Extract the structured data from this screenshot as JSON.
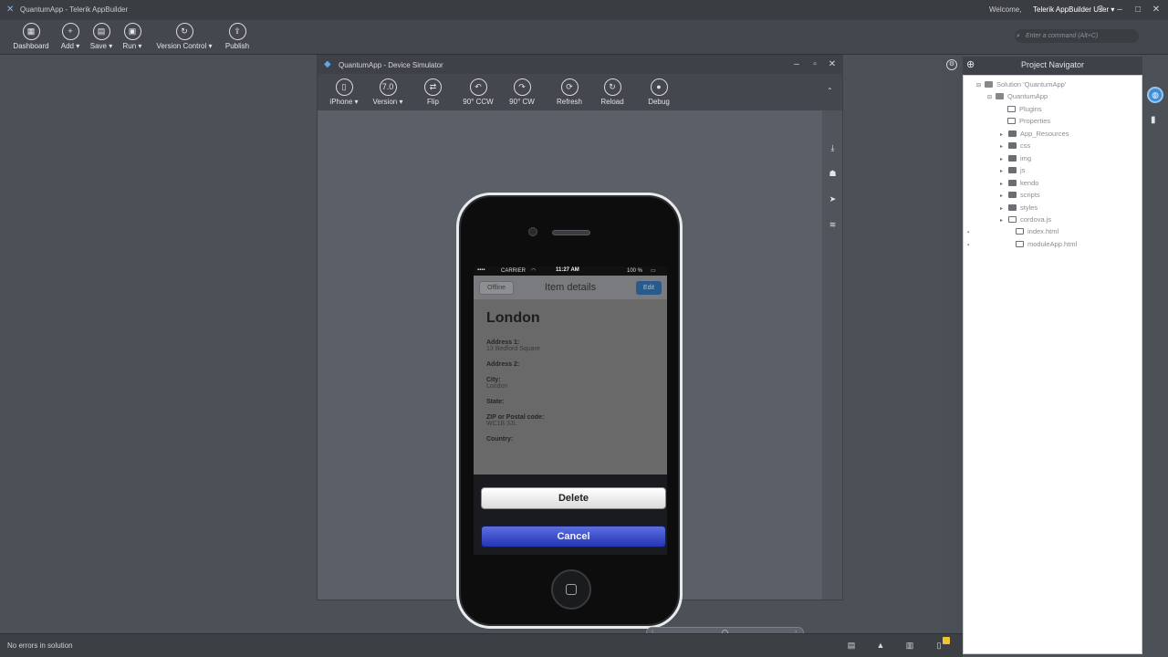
{
  "app": {
    "title": "QuantumApp - Telerik AppBuilder",
    "welcome": "Welcome,",
    "user": "Telerik AppBuilder User ▾"
  },
  "window_controls": {
    "help": "?",
    "minimize": "–",
    "maximize": "□",
    "close": "✕"
  },
  "toolbar": [
    {
      "label": "Dashboard",
      "icon": "dashboard-icon"
    },
    {
      "label": "Add ▾",
      "icon": "plus-icon"
    },
    {
      "label": "Save ▾",
      "icon": "save-icon"
    },
    {
      "label": "Run ▾",
      "icon": "run-icon"
    },
    {
      "label": "Version Control ▾",
      "icon": "version-control-icon"
    },
    {
      "label": "Publish",
      "icon": "publish-icon"
    }
  ],
  "command": {
    "placeholder": "Enter a command (Alt+C)"
  },
  "simulator": {
    "title": "QuantumApp - Device Simulator",
    "tools": [
      {
        "label": "iPhone ▾"
      },
      {
        "label": "Version ▾"
      },
      {
        "label": "Flip"
      },
      {
        "label": "90° CCW"
      },
      {
        "label": "90° CW"
      },
      {
        "label": "Refresh"
      },
      {
        "label": "Reload"
      },
      {
        "label": "Debug"
      }
    ]
  },
  "device": {
    "status": {
      "carrier": "CARRIER",
      "time": "11:27 AM",
      "battery": "100 %"
    },
    "nav": {
      "back": "Offline",
      "title": "Item details",
      "edit": "Edit"
    },
    "city": "London",
    "fields": [
      {
        "label": "Address 1:",
        "value": "13 Bedford Square"
      },
      {
        "label": "Address 2:",
        "value": ""
      },
      {
        "label": "City:",
        "value": "London"
      },
      {
        "label": "State:",
        "value": ""
      },
      {
        "label": "ZIP or Postal code:",
        "value": "WC1B 3JL"
      },
      {
        "label": "Country:",
        "value": ""
      }
    ],
    "sheet": {
      "delete": "Delete",
      "cancel": "Cancel"
    }
  },
  "navigator": {
    "title": "Project Navigator",
    "items": [
      {
        "label": "Solution 'QuantumApp'"
      },
      {
        "label": "QuantumApp"
      },
      {
        "label": "Plugins"
      },
      {
        "label": "Properties"
      },
      {
        "label": "App_Resources"
      },
      {
        "label": "css"
      },
      {
        "label": "img"
      },
      {
        "label": "js"
      },
      {
        "label": "kendo"
      },
      {
        "label": "scripts"
      },
      {
        "label": "styles"
      },
      {
        "label": "cordova.js"
      },
      {
        "label": "index.html"
      },
      {
        "label": "moduleApp.html"
      }
    ]
  },
  "status": {
    "text": "No errors in solution"
  }
}
